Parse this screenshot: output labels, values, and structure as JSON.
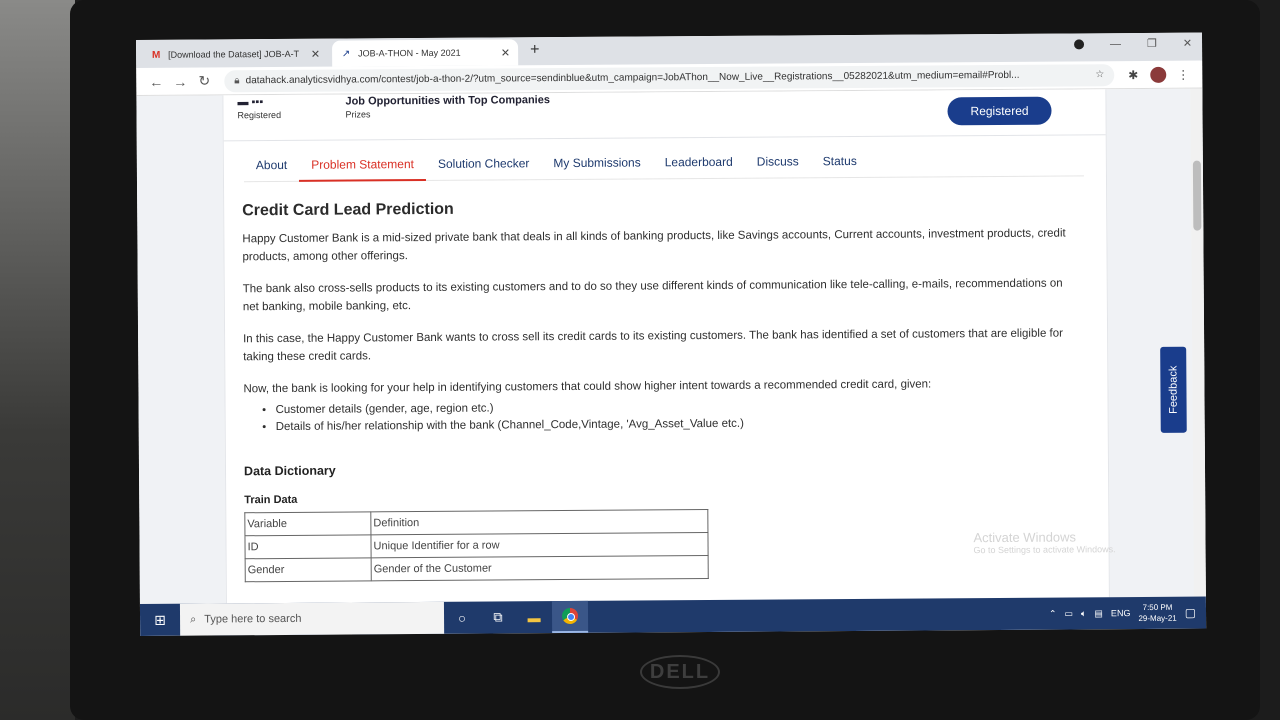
{
  "browser": {
    "tabs": [
      {
        "title": "[Download the Dataset] JOB-A-T",
        "icon": "gmail-icon",
        "active": false
      },
      {
        "title": "JOB-A-THON - May 2021",
        "icon": "analytics-vidhya-icon",
        "active": true
      }
    ],
    "url": "datahack.analyticsvidhya.com/contest/job-a-thon-2/?utm_source=sendinblue&utm_campaign=JobAThon__Now_Live__Registrations__05282021&utm_medium=email#Probl..."
  },
  "header": {
    "stat_registered_label": "Registered",
    "stat_prizes_label": "Prizes",
    "stat_prizes_value": "Job Opportunities with Top Companies",
    "registered_button": "Registered"
  },
  "nav": {
    "tabs": [
      "About",
      "Problem Statement",
      "Solution Checker",
      "My Submissions",
      "Leaderboard",
      "Discuss",
      "Status"
    ],
    "active": "Problem Statement"
  },
  "content": {
    "title": "Credit Card Lead Prediction",
    "p1": "Happy Customer Bank is a mid-sized private bank that deals in all kinds of banking products, like Savings accounts, Current accounts, investment products, credit products, among other offerings.",
    "p2": "The bank also cross-sells products to its existing customers and to do so they use different kinds of communication like tele-calling, e-mails, recommendations on net banking, mobile banking, etc.",
    "p3": "In this case, the Happy Customer Bank wants to cross sell its credit cards to its existing customers. The bank has identified a set of customers that are eligible for taking these credit cards.",
    "p4": "Now, the bank is looking for your help in identifying customers that could show higher intent towards a recommended credit card, given:",
    "bullets": [
      "Customer details (gender, age, region etc.)",
      "Details of his/her relationship with the bank (Channel_Code,Vintage, 'Avg_Asset_Value etc.)"
    ],
    "data_dictionary": "Data Dictionary",
    "train_data": "Train Data",
    "table": [
      [
        "Variable",
        "Definition"
      ],
      [
        "ID",
        "Unique Identifier for a row"
      ],
      [
        "Gender",
        "Gender of the Customer"
      ]
    ]
  },
  "feedback_label": "Feedback",
  "watermark": {
    "line1": "Activate Windows",
    "line2": "Go to Settings to activate Windows."
  },
  "taskbar": {
    "search_placeholder": "Type here to search",
    "language": "ENG",
    "time": "7:50 PM",
    "date": "29-May-21"
  },
  "device": {
    "brand": "DELL"
  }
}
